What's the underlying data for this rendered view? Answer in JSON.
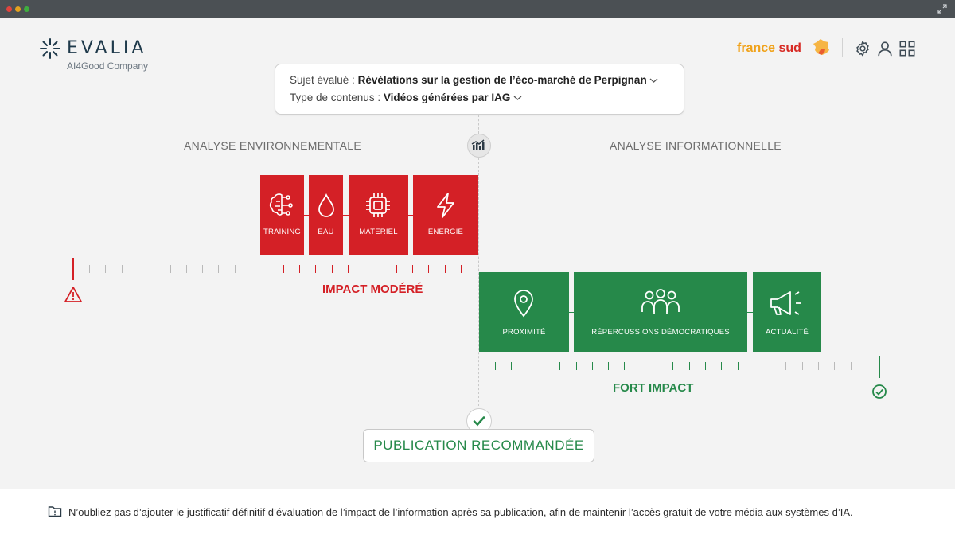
{
  "app": {
    "logo_text": "EVALIA",
    "logo_subtitle": "AI4Good Company"
  },
  "header": {
    "brand_part1": "france",
    "brand_part2": "sud",
    "icons": [
      "settings-icon",
      "user-icon",
      "grid-icon"
    ]
  },
  "subject": {
    "subject_label": "Sujet évalué :",
    "subject_value": "Révélations sur la gestion de l’éco-marché de Perpignan",
    "content_label": "Type de contenus :",
    "content_value": "Vidéos générées par IAG"
  },
  "sections": {
    "left_title": "ANALYSE ENVIRONNEMENTALE",
    "right_title": "ANALYSE INFORMATIONNELLE"
  },
  "environmental": {
    "items": [
      {
        "label": "TRAINING",
        "icon": "brain-circuit-icon"
      },
      {
        "label": "EAU",
        "icon": "water-drop-icon"
      },
      {
        "label": "MATÉRIEL",
        "icon": "chip-icon"
      },
      {
        "label": "ÉNERGIE",
        "icon": "lightning-icon"
      }
    ],
    "impact_label": "IMPACT MODÉRÉ",
    "color": "#d42026"
  },
  "informational": {
    "items": [
      {
        "label": "PROXIMITÉ",
        "icon": "location-pin-icon"
      },
      {
        "label": "RÉPERCUSSIONS DÉMOCRATIQUES",
        "icon": "people-group-icon"
      },
      {
        "label": "ACTUALITÉ",
        "icon": "megaphone-icon"
      }
    ],
    "impact_label": "FORT IMPACT",
    "color": "#26894a"
  },
  "result": {
    "label": "PUBLICATION RECOMMANDÉE"
  },
  "footer": {
    "text": "N’oubliez pas d’ajouter le justificatif définitif d’évaluation de l’impact de l’information après sa publication, afin de maintenir l’accès gratuit de votre média aux systèmes d’IA."
  }
}
